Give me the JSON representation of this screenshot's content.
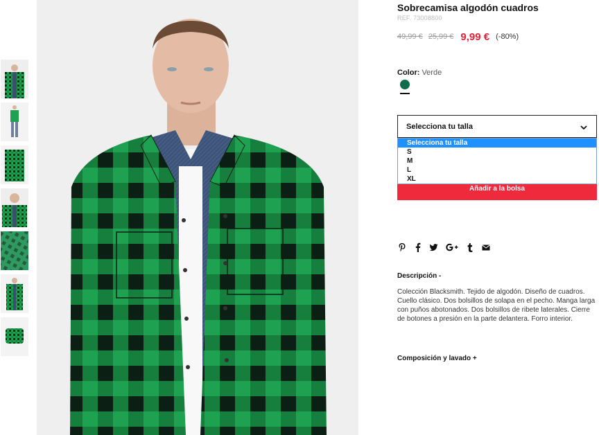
{
  "product": {
    "title": "Sobrecamisa algodón cuadros",
    "ref": "REF. 73008800",
    "old_price_1": "49,99 €",
    "old_price_2": "25,99 €",
    "price": "9,99 €",
    "discount": "(-80%)"
  },
  "color": {
    "label": "Color:",
    "value": "Verde",
    "swatch": "#0f6d4d"
  },
  "size_select": {
    "selected": "Selecciona tu talla",
    "options": [
      "Selecciona tu talla",
      "S",
      "M",
      "L",
      "XL"
    ]
  },
  "add_to_bag": "Añadir a la bolsa",
  "share_icons": [
    "pinterest-icon",
    "facebook-icon",
    "twitter-icon",
    "google-plus-icon",
    "tumblr-icon",
    "email-icon"
  ],
  "description": {
    "title": "Descripción -",
    "text": "Colección Blacksmith. Tejido de algodón. Diseño de cuadros. Cuello clásico. Dos bolsillos de solapa en el pecho. Manga larga con puños abotonados. Dos bolsillos de ribete laterales. Cierre de botones a presión en la parte delantera. Forro interior."
  },
  "composition": {
    "title": "Composición y lavado +"
  },
  "theme": {
    "accent_red": "#e0223a",
    "button_red": "#ee2a3c",
    "select_highlight": "#1e90ff",
    "shirt_green": "#1fa152"
  }
}
